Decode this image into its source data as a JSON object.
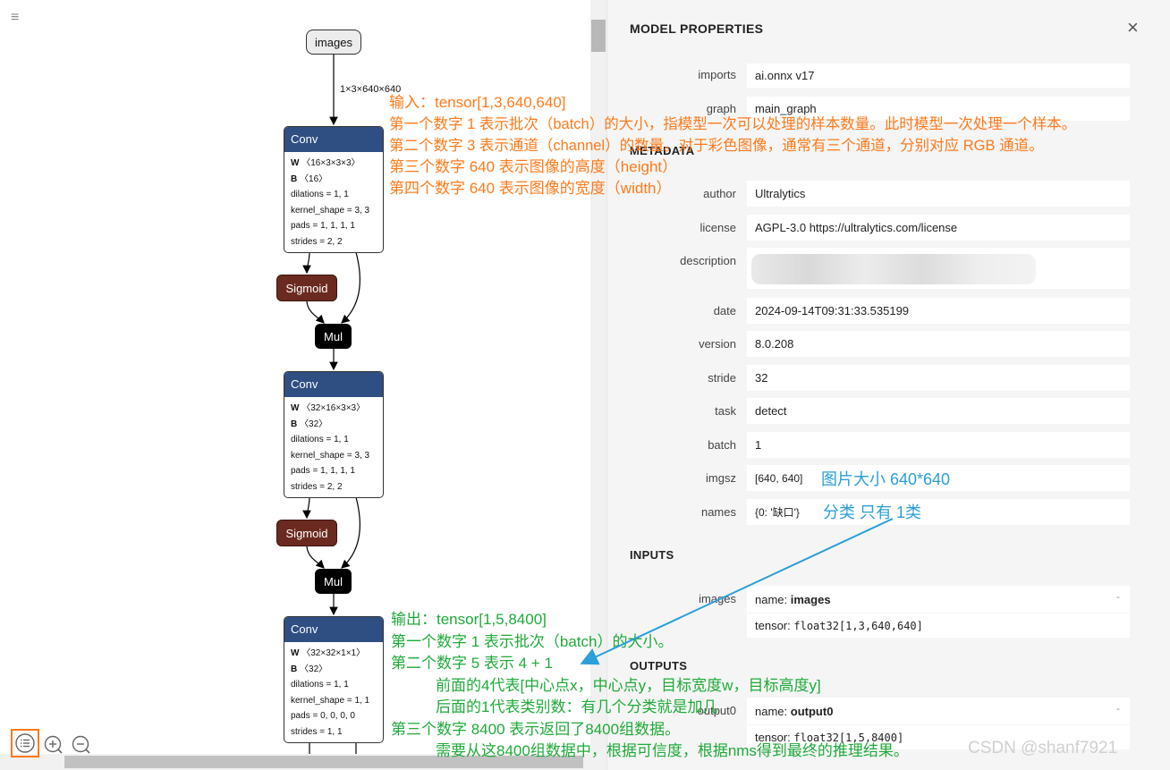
{
  "graph": {
    "input_node": "images",
    "edge_label": "1×3×640×640",
    "conv_blocks": [
      {
        "title": "Conv",
        "w": "〈16×3×3×3〉",
        "b": "〈16〉",
        "attrs": [
          "dilations = 1, 1",
          "kernel_shape = 3, 3",
          "pads = 1, 1, 1, 1",
          "strides = 2, 2"
        ]
      },
      {
        "title": "Conv",
        "w": "〈32×16×3×3〉",
        "b": "〈32〉",
        "attrs": [
          "dilations = 1, 1",
          "kernel_shape = 3, 3",
          "pads = 1, 1, 1, 1",
          "strides = 2, 2"
        ]
      },
      {
        "title": "Conv",
        "w": "〈32×32×1×1〉",
        "b": "〈32〉",
        "attrs": [
          "dilations = 1, 1",
          "kernel_shape = 1, 1",
          "pads = 0, 0, 0, 0",
          "strides = 1, 1"
        ]
      }
    ],
    "w_prefix": "W",
    "b_prefix": "B",
    "sigmoid_label": "Sigmoid",
    "mul_label": "Mul"
  },
  "annotations": {
    "input_lines": [
      "输入：tensor[1,3,640,640]",
      "第一个数字 1 表示批次（batch）的大小，指模型一次可以处理的样本数量。此时模型一次处理一个样本。",
      "第二个数字 3 表示通道（channel）的数量。对于彩色图像，通常有三个通道，分别对应 RGB 通道。",
      "第三个数字 640 表示图像的高度（height）",
      "第四个数字 640 表示图像的宽度（width）"
    ],
    "output_lines": [
      "输出：tensor[1,5,8400]",
      "第一个数字 1 表示批次（batch）的大小。",
      "第二个数字 5 表示 4 + 1",
      "前面的4代表[中心点x，中心点y，目标宽度w，目标高度y]",
      "后面的1代表类别数：有几个分类就是加几",
      "第三个数字 8400 表示返回了8400组数据。",
      "需要从这8400组数据中，根据可信度，根据nms得到最终的推理结果。"
    ],
    "imgsz_note": "图片大小 640*640",
    "names_note": "分类 只有 1类"
  },
  "toolbar": {
    "menu_icon": "≡"
  },
  "sidebar": {
    "title": "MODEL PROPERTIES",
    "close": "×",
    "metadata_header": "METADATA",
    "inputs_header": "INPUTS",
    "outputs_header": "OUTPUTS",
    "props": [
      {
        "label": "imports",
        "value": "ai.onnx v17"
      },
      {
        "label": "graph",
        "value": "main_graph"
      },
      {
        "label": "author",
        "value": "Ultralytics"
      },
      {
        "label": "license",
        "value": "AGPL-3.0 https://ultralytics.com/license"
      },
      {
        "label": "description",
        "value": ""
      },
      {
        "label": "date",
        "value": "2024-09-14T09:31:33.535199"
      },
      {
        "label": "version",
        "value": "8.0.208"
      },
      {
        "label": "stride",
        "value": "32"
      },
      {
        "label": "task",
        "value": "detect"
      },
      {
        "label": "batch",
        "value": "1"
      },
      {
        "label": "imgsz",
        "value": "[640, 640]"
      },
      {
        "label": "names",
        "value": "{0: '缺口'}"
      }
    ],
    "input": {
      "label": "images",
      "name_prefix": "name:",
      "name": "images",
      "tensor_prefix": "tensor:",
      "tensor": "float32[1,3,640,640]"
    },
    "output": {
      "label": "output0",
      "name_prefix": "name:",
      "name": "output0",
      "tensor_prefix": "tensor:",
      "tensor": "float32[1,5,8400]"
    },
    "expand_marker": "-"
  },
  "watermark": "CSDN @shanf7921",
  "colors": {
    "conv_header": "#2f4e82",
    "sigmoid": "#6b2a1f",
    "mul": "#000000",
    "annotation_orange": "#ff7a1a",
    "annotation_green": "#1faa3a",
    "annotation_blue": "#2a9fd8",
    "highlight_box": "#ff7a1a"
  }
}
